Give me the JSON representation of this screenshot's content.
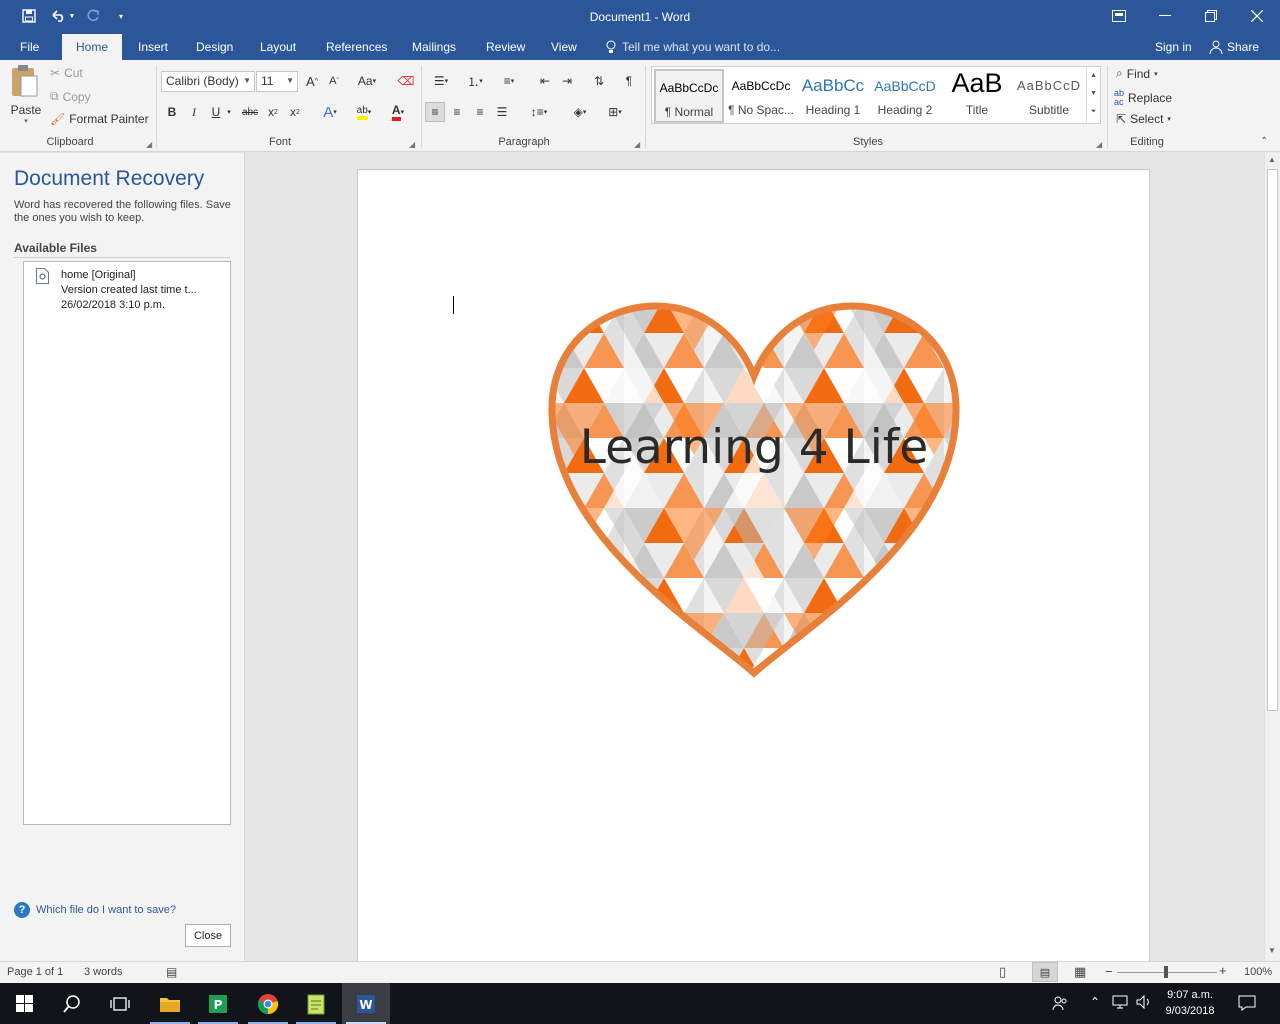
{
  "window": {
    "title": "Document1 - Word"
  },
  "tabs": [
    "File",
    "Home",
    "Insert",
    "Design",
    "Layout",
    "References",
    "Mailings",
    "Review",
    "View"
  ],
  "active_tab": "Home",
  "tell_me": "Tell me what you want to do...",
  "account": {
    "sign_in": "Sign in",
    "share": "Share"
  },
  "clipboard": {
    "paste": "Paste",
    "cut": "Cut",
    "copy": "Copy",
    "format_painter": "Format Painter",
    "label": "Clipboard"
  },
  "font": {
    "name": "Calibri (Body)",
    "size": "11",
    "label": "Font"
  },
  "paragraph": {
    "label": "Paragraph"
  },
  "styles": {
    "label": "Styles",
    "items": [
      {
        "preview": "AaBbCcDc",
        "name": "¶ Normal"
      },
      {
        "preview": "AaBbCcDc",
        "name": "¶ No Spac..."
      },
      {
        "preview": "AaBbCc",
        "name": "Heading 1"
      },
      {
        "preview": "AaBbCcD",
        "name": "Heading 2"
      },
      {
        "preview": "AaB",
        "name": "Title"
      },
      {
        "preview": "AaBbCcD",
        "name": "Subtitle"
      }
    ]
  },
  "editing": {
    "find": "Find",
    "replace": "Replace",
    "select": "Select",
    "label": "Editing"
  },
  "recovery": {
    "title": "Document Recovery",
    "desc": "Word has recovered the following files. Save the ones you wish to keep.",
    "available": "Available Files",
    "file": {
      "name": "home  [Original]",
      "detail": "Version created last time t...",
      "date": "26/02/2018 3:10 p.m."
    },
    "help": "Which file do I want to save?",
    "close": "Close"
  },
  "document": {
    "heart_text": "Learning 4 Life"
  },
  "status": {
    "page": "Page 1 of 1",
    "words": "3 words",
    "zoom": "100%"
  },
  "taskbar": {
    "time": "9:07 a.m.",
    "date": "9/03/2018"
  },
  "colors": {
    "accent": "#2b579a",
    "heart_orange": "#e8803a"
  }
}
